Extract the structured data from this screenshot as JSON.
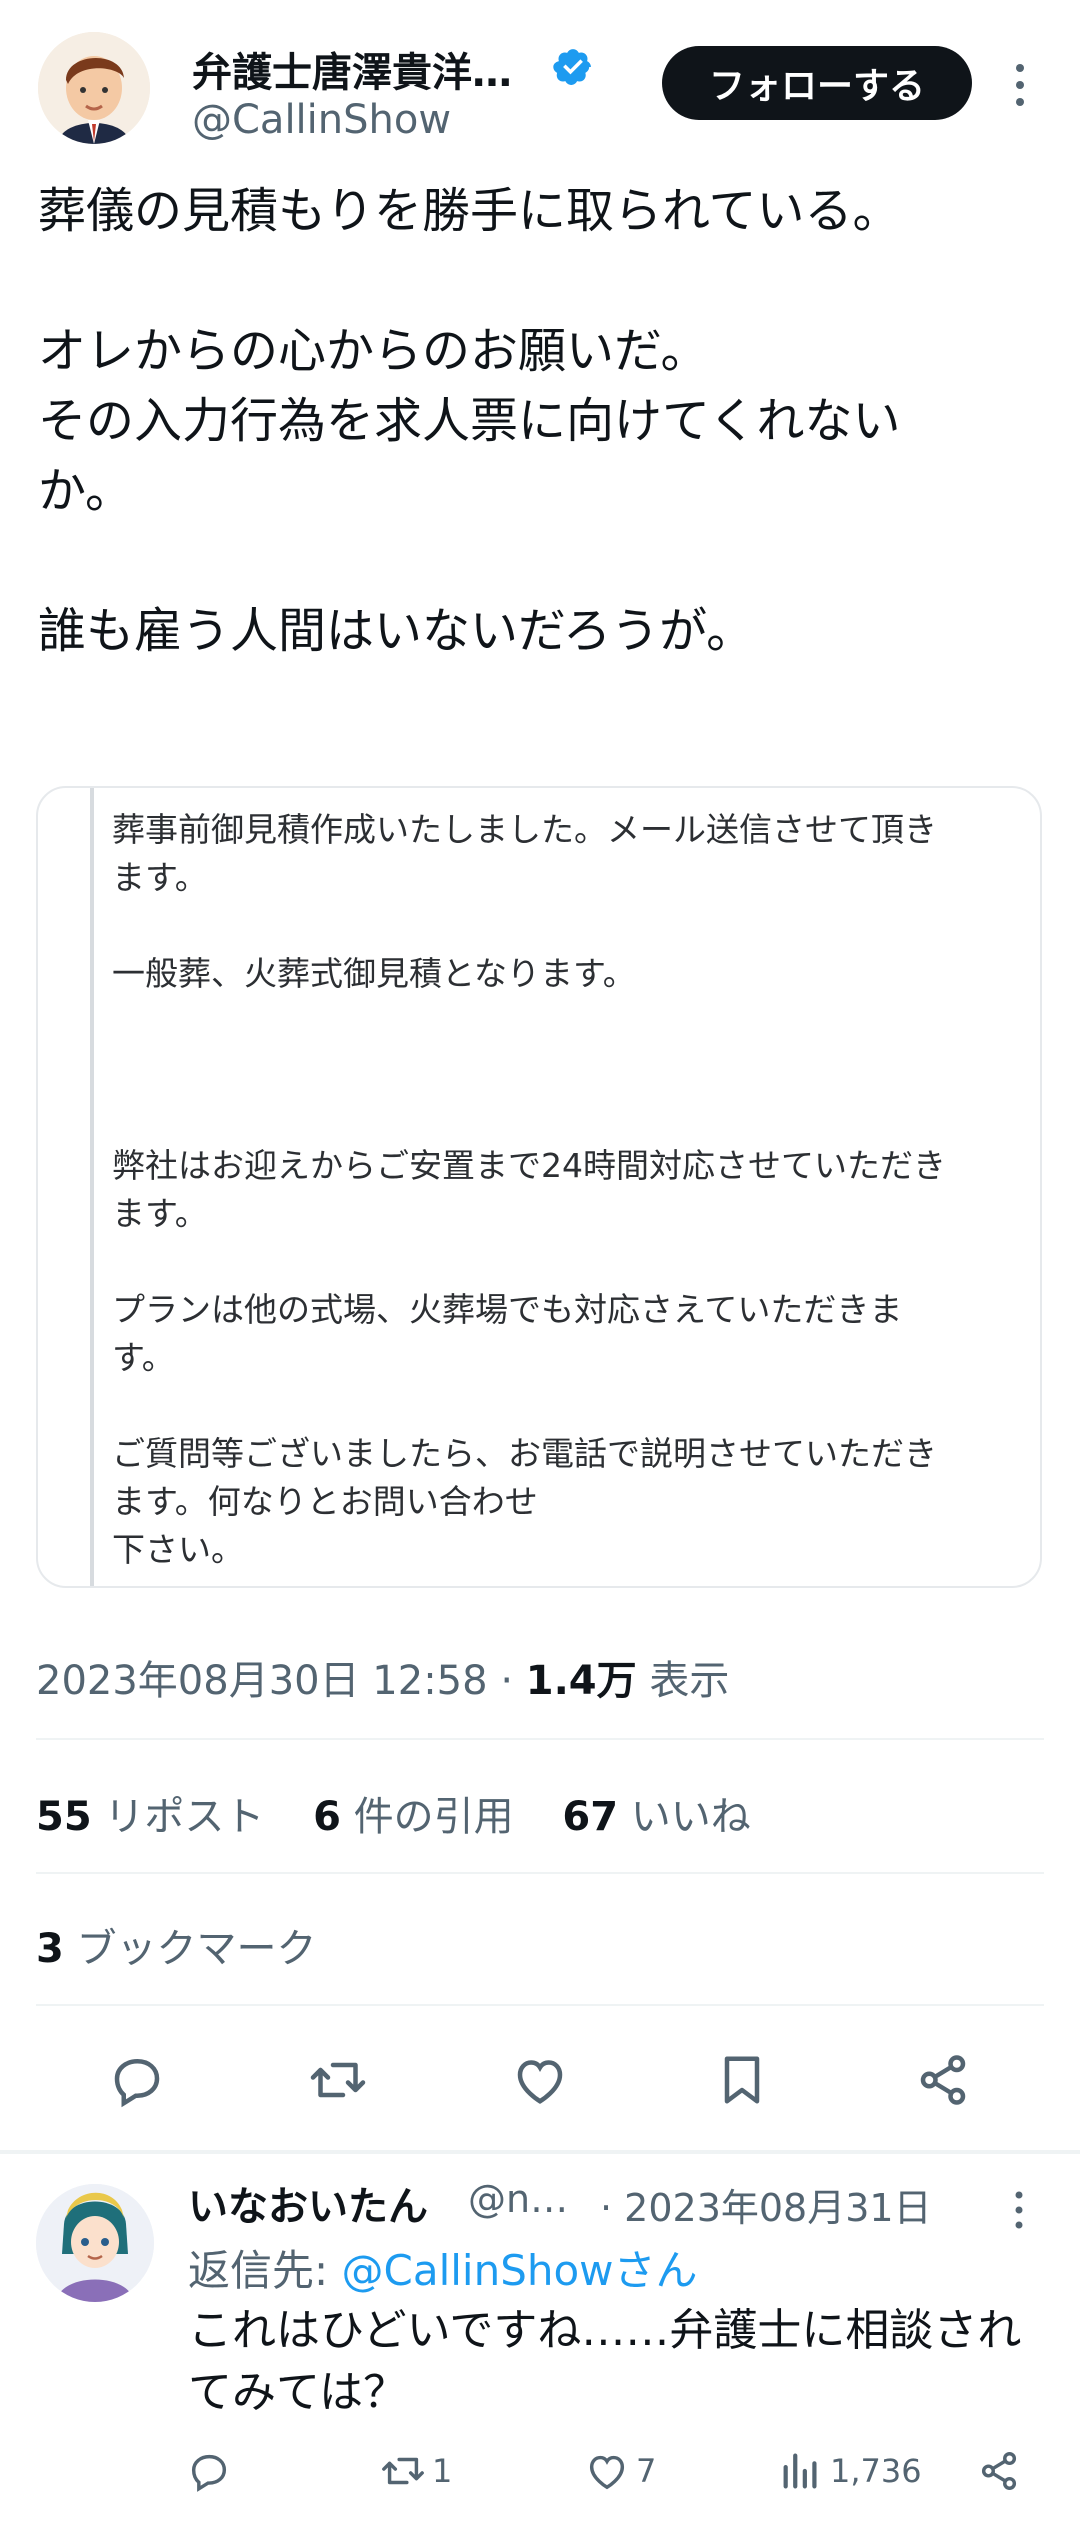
{
  "author": {
    "display_name": "弁護士唐澤貴洋…",
    "handle": "@CallinShow",
    "follow_label": "フォローする"
  },
  "tweet": {
    "text": "葬儀の見積もりを勝手に取られている。\n\nオレからの心からのお願いだ。\nその入力行為を求人票に向けてくれない\nか。\n\n誰も雇う人間はいないだろうが。",
    "card_text": "葬事前御見積作成いたしました。メール送信させて頂き\nます。\n\n一般葬、火葬式御見積となります。\n\n\n\n弊社はお迎えからご安置まで24時間対応させていただき\nます。\n\nプランは他の式場、火葬場でも対応さえていただきま\nす。\n\nご質問等ございましたら、お電話で説明させていただき\nます。何なりとお問い合わせ\n下さい。",
    "datetime": "2023年08月30日 12:58",
    "dot": "·",
    "views_count": "1.4万",
    "views_label": "表示"
  },
  "stats": {
    "reposts_count": "55",
    "reposts_label": "リポスト",
    "quotes_count": "6",
    "quotes_label": "件の引用",
    "likes_count": "67",
    "likes_label": "いいね",
    "bookmarks_count": "3",
    "bookmarks_label": "ブックマーク"
  },
  "reply": {
    "display_name": "いなおいたん",
    "handle": "@n…",
    "date": "· 2023年08月31日",
    "reply_to_prefix": "返信先: ",
    "reply_to_handle": "@CallinShowさん",
    "text": "これはひどいですね……弁護士に相談され\nてみては？",
    "retweets": "1",
    "likes": "7",
    "views": "1,736"
  },
  "colors": {
    "accent": "#1d9bf0",
    "text_primary": "#0f1419",
    "text_secondary": "#536471"
  },
  "icons": [
    "verified-badge-icon",
    "more-icon",
    "reply-icon",
    "retweet-icon",
    "like-icon",
    "bookmark-icon",
    "share-icon",
    "views-icon"
  ]
}
